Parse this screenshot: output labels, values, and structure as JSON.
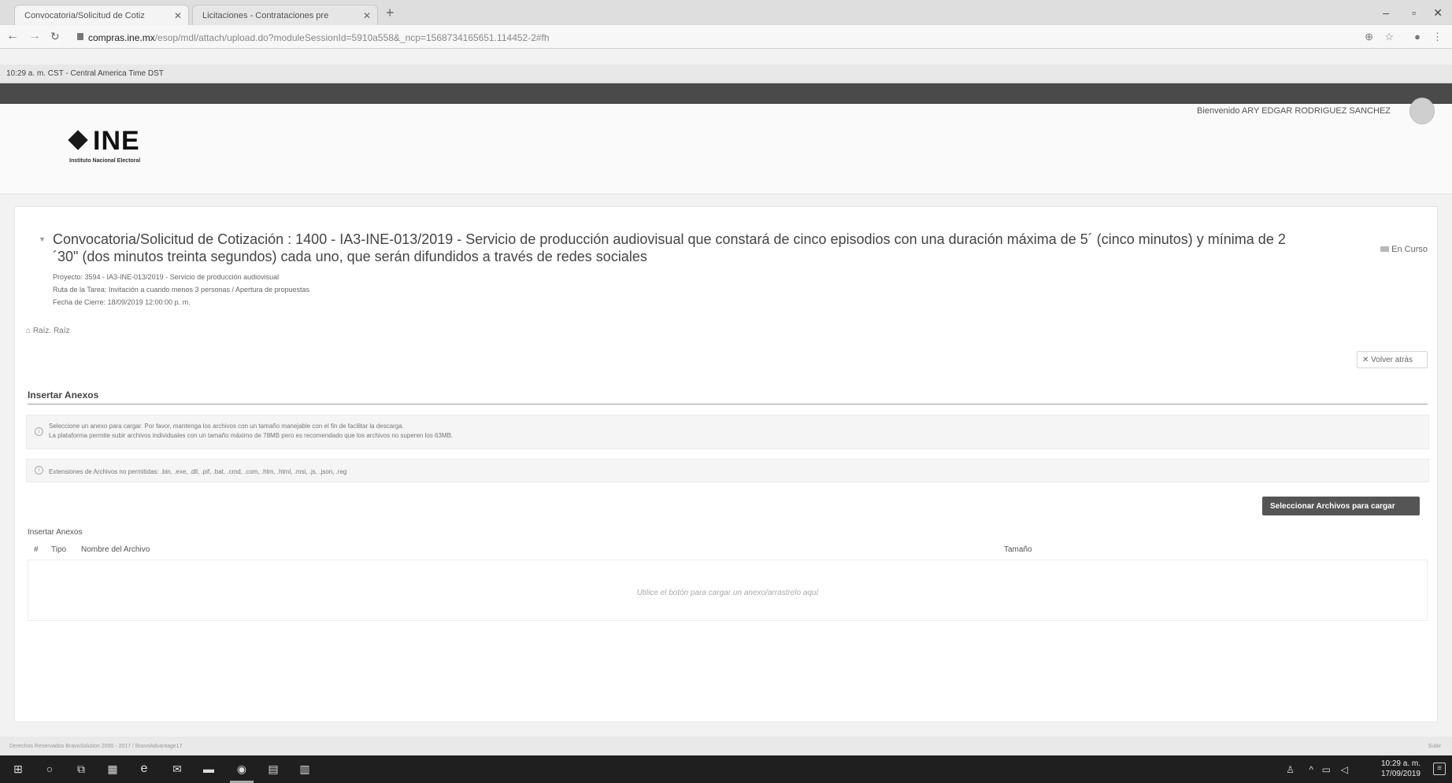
{
  "browser": {
    "tabs": [
      {
        "label": "Convocatoria/Solicitud de Cotiz"
      },
      {
        "label": "Licitaciones - Contrataciones pre"
      }
    ],
    "url_host": "compras.ine.mx",
    "url_path": "/esop/mdl/attach/upload.do?moduleSessionId=5910a558&_ncp=1568734165651.114452-2#fh"
  },
  "timebar": {
    "text": "10:29 a. m. CST - Central America Time DST"
  },
  "header": {
    "logo_text": "INE",
    "logo_subtitle": "Instituto Nacional Electoral",
    "welcome": "Bienvenido ARY EDGAR RODRIGUEZ SANCHEZ"
  },
  "main": {
    "title": "Convocatoria/Solicitud de Cotización : 1400 - IA3-INE-013/2019 - Servicio de producción audiovisual que constará de cinco episodios con una duración máxima de 5´ (cinco minutos) y mínima de 2´30\" (dos minutos treinta segundos) cada uno, que serán difundidos a través de redes sociales",
    "status": "En Curso",
    "project": "Proyecto: 3594 - IA3-INE-013/2019 - Servicio de producción audiovisual",
    "task_path": "Ruta de la Tarea: Invitación a cuando menos 3 personas / Apertura de propuestas",
    "close_date": "Fecha de Cierre: 18/09/2019 12:00:00 p. m.",
    "root": "Raíz. Raíz",
    "back_button": "Volver atrás",
    "section_title": "Insertar Anexos",
    "notice1_line1": "Seleccione un anexo para cargar. Por favor, mantenga los archivos con un tamaño manejable con el fin de facilitar la descarga.",
    "notice1_line2": "La plataforma permite subir archivos individuales con un tamaño máximo de 78MB pero es recomendado que los archivos no superen los 63MB.",
    "notice2": "Extensiones de Archivos no permitidas: .bin, .exe, .dll, .pif, .bat, .cmd, .com, .htm, .html, .msi, .js, .json, .reg",
    "select_button": "Seleccionar Archivos para cargar",
    "table_title": "Insertar Anexos",
    "columns": {
      "num": "#",
      "type": "Tipo",
      "name": "Nombre del Archivo",
      "size": "Tamaño"
    },
    "empty_text": "Utilice el botón para cargar un anexo/arrastrelo aquí"
  },
  "footer": {
    "left": "Derechos Reservados BravoSolution 2000 - 2017 / BravoAdvantage17",
    "right": "Subir"
  },
  "taskbar": {
    "time": "10:29 a. m.",
    "date": "17/09/2019"
  }
}
